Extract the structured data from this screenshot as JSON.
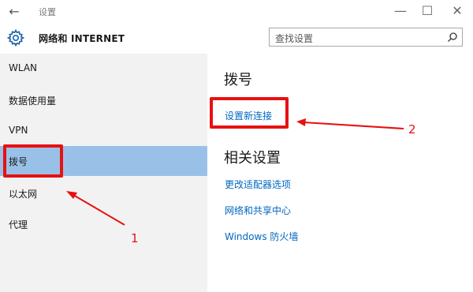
{
  "window": {
    "back_glyph": "←",
    "title": "设置",
    "minimize_glyph": "—",
    "maximize_glyph": "☐",
    "close_glyph": "✕"
  },
  "header": {
    "section_title": "网络和 INTERNET",
    "search_placeholder": "查找设置"
  },
  "sidebar": {
    "items": [
      {
        "label": "WLAN",
        "selected": false
      },
      {
        "label": "数据使用量",
        "selected": false
      },
      {
        "label": "VPN",
        "selected": false
      },
      {
        "label": "拨号",
        "selected": true
      },
      {
        "label": "以太网",
        "selected": false
      },
      {
        "label": "代理",
        "selected": false
      }
    ]
  },
  "main": {
    "heading": "拨号",
    "setup_link": "设置新连接",
    "related_heading": "相关设置",
    "related_links": [
      "更改适配器选项",
      "网络和共享中心",
      "Windows 防火墙"
    ]
  },
  "annotations": {
    "label_1": "1",
    "label_2": "2",
    "color": "#e81010"
  },
  "colors": {
    "selected_bg": "#99c1e8",
    "sidebar_bg": "#f2f2f2",
    "link": "#0067c0"
  }
}
